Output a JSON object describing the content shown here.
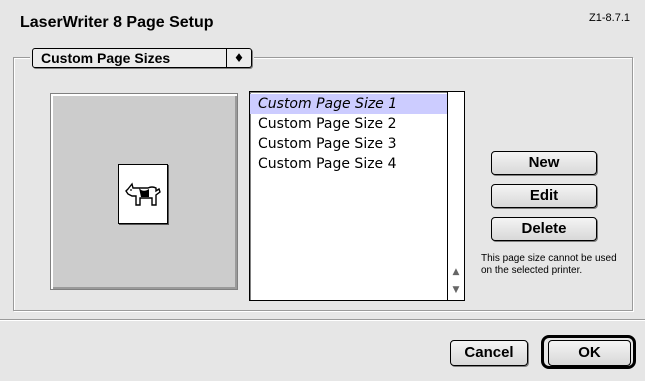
{
  "window": {
    "title": "LaserWriter 8 Page Setup",
    "version": "Z1-8.7.1"
  },
  "popup": {
    "selected": "Custom Page Sizes",
    "arrows_glyph": "♦"
  },
  "page_sizes": {
    "items": [
      {
        "label": "Custom Page Size 1",
        "selected": true
      },
      {
        "label": "Custom Page Size 2",
        "selected": false
      },
      {
        "label": "Custom Page Size 3",
        "selected": false
      },
      {
        "label": "Custom Page Size 4",
        "selected": false
      }
    ],
    "scroll_up_glyph": "▲",
    "scroll_down_glyph": "▼"
  },
  "actions": {
    "new_label": "New",
    "edit_label": "Edit",
    "delete_label": "Delete"
  },
  "note": "This page size cannot be used on the selected printer.",
  "footer": {
    "cancel_label": "Cancel",
    "ok_label": "OK"
  },
  "colors": {
    "dialog_background": "#e6e6e6",
    "selection_highlight": "#ccccff",
    "preview_background": "#cccccc"
  },
  "icons": {
    "preview": "dogcow-page-icon",
    "popup_arrows": "popup-up-down-arrows-icon"
  }
}
